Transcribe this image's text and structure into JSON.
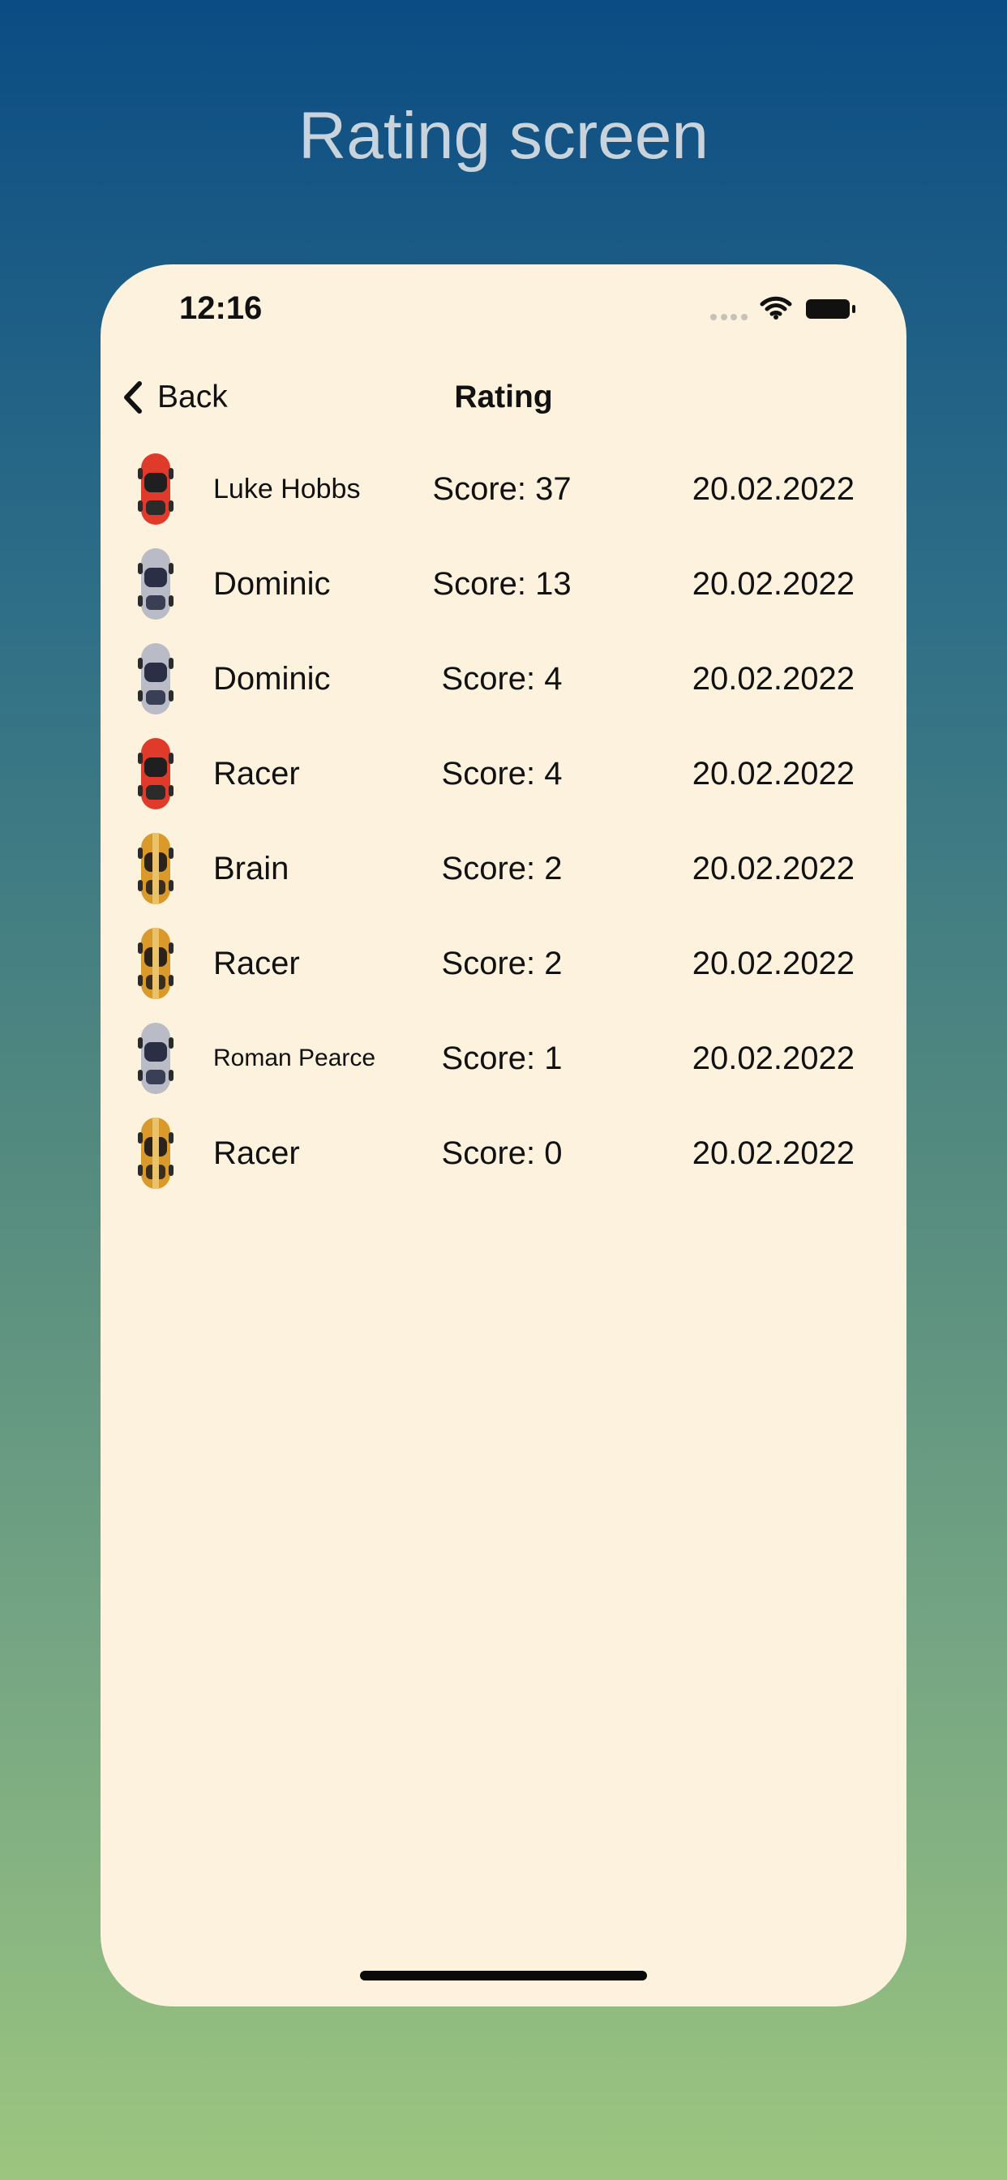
{
  "page_heading": "Rating screen",
  "status_bar": {
    "time": "12:16"
  },
  "navigation": {
    "back_label": "Back",
    "title": "Rating"
  },
  "ratings": [
    {
      "player": "Luke Hobbs",
      "score": "Score: 37",
      "date": "20.02.2022",
      "car": "red-car-icon"
    },
    {
      "player": "Dominic",
      "score": "Score: 13",
      "date": "20.02.2022",
      "car": "silver-car-icon"
    },
    {
      "player": "Dominic",
      "score": "Score: 4",
      "date": "20.02.2022",
      "car": "silver-car-icon"
    },
    {
      "player": "Racer",
      "score": "Score: 4",
      "date": "20.02.2022",
      "car": "red-car-icon"
    },
    {
      "player": "Brain",
      "score": "Score: 2",
      "date": "20.02.2022",
      "car": "yellow-car-icon"
    },
    {
      "player": "Racer",
      "score": "Score: 2",
      "date": "20.02.2022",
      "car": "yellow-car-icon"
    },
    {
      "player": "Roman Pearce",
      "score": "Score: 1",
      "date": "20.02.2022",
      "car": "silver-car-icon"
    },
    {
      "player": "Racer",
      "score": "Score: 0",
      "date": "20.02.2022",
      "car": "yellow-car-icon"
    }
  ],
  "colors": {
    "background_top": "#0b4c84",
    "background_bottom": "#9cc67f",
    "card_background": "#fdf2de",
    "heading_text": "#c8d3dc",
    "text": "#111111",
    "red_car": "#df3a2a",
    "silver_car": "#b9bcc7",
    "yellow_car": "#d99a2b"
  }
}
